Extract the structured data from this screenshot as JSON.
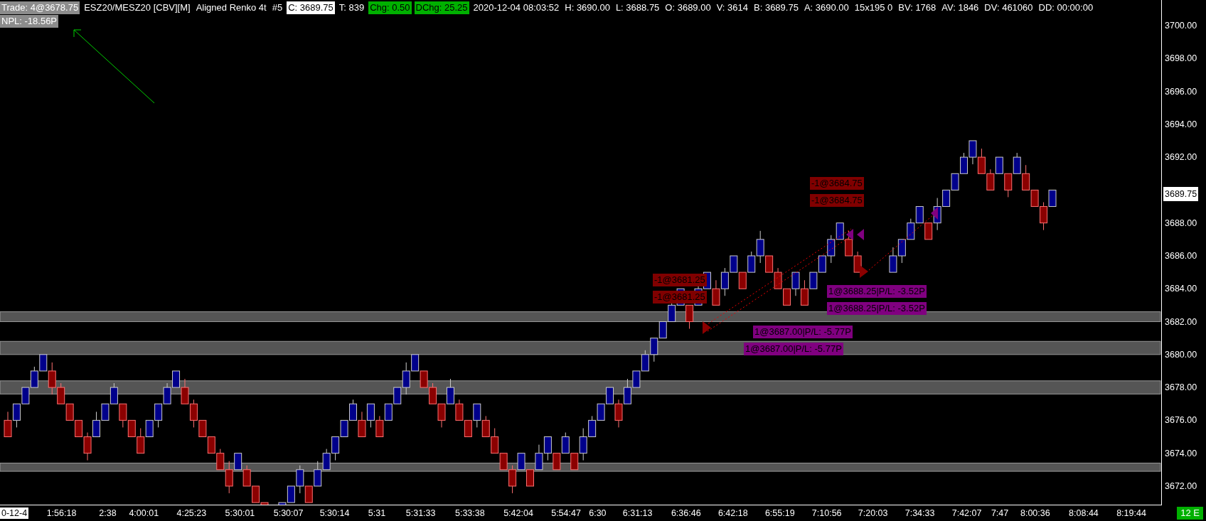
{
  "header": {
    "fields": [
      {
        "text": "Trade: 4@3678.75",
        "kind": "grey"
      },
      {
        "text": "ESZ20/MESZ20 [CBV][M]",
        "kind": "plain"
      },
      {
        "text": "Aligned Renko 4t",
        "kind": "plain"
      },
      {
        "text": "#5",
        "kind": "plain"
      },
      {
        "text": "C: 3689.75",
        "kind": "white"
      },
      {
        "text": "T: 839",
        "kind": "plain"
      },
      {
        "text": "Chg: 0.50",
        "kind": "green"
      },
      {
        "text": "DChg: 25.25",
        "kind": "green"
      },
      {
        "text": "2020-12-04 08:03:52",
        "kind": "plain"
      },
      {
        "text": "H: 3690.00",
        "kind": "plain"
      },
      {
        "text": "L: 3688.75",
        "kind": "plain"
      },
      {
        "text": "O: 3689.00",
        "kind": "plain"
      },
      {
        "text": "V: 3614",
        "kind": "plain"
      },
      {
        "text": "B: 3689.75",
        "kind": "plain"
      },
      {
        "text": "A: 3690.00",
        "kind": "plain"
      },
      {
        "text": "15x195 0",
        "kind": "plain"
      },
      {
        "text": "BV: 1768",
        "kind": "plain"
      },
      {
        "text": "AV: 1846",
        "kind": "plain"
      },
      {
        "text": "DV: 461060",
        "kind": "plain"
      },
      {
        "text": "DD: 00:00:00",
        "kind": "plain"
      }
    ],
    "npl": "NPL: -18.56P"
  },
  "trade_labels": [
    {
      "text": "-1@3684.75",
      "kind": "sell"
    },
    {
      "text": "-1@3684.75",
      "kind": "sell"
    },
    {
      "text": "-1@3681.25",
      "kind": "sell"
    },
    {
      "text": "-1@3681.25",
      "kind": "sell"
    },
    {
      "text": "1@3688.25|P/L: -3.52P",
      "kind": "buy"
    },
    {
      "text": "1@3688.25|P/L: -3.52P",
      "kind": "buy"
    },
    {
      "text": "1@3687.00|P/L: -5.77P",
      "kind": "buy"
    },
    {
      "text": "1@3687.00|P/L: -5.77P",
      "kind": "buy"
    }
  ],
  "price_axis": {
    "ticks": [
      "3700.00",
      "3698.00",
      "3696.00",
      "3694.00",
      "3692.00",
      "3688.00",
      "3686.00",
      "3684.00",
      "3682.00",
      "3680.00",
      "3678.00",
      "3676.00",
      "3674.00",
      "3672.00"
    ],
    "current_price": "3689.75"
  },
  "time_axis": {
    "labels": [
      {
        "text": "0-12-4",
        "kind": "highlight"
      },
      {
        "text": "1:56:18",
        "kind": "plain"
      },
      {
        "text": "2:38",
        "kind": "plain"
      },
      {
        "text": "4:00:01",
        "kind": "plain"
      },
      {
        "text": "4:25:23",
        "kind": "plain"
      },
      {
        "text": "5:30:01",
        "kind": "plain"
      },
      {
        "text": "5:30:07",
        "kind": "plain"
      },
      {
        "text": "5:30:14",
        "kind": "plain"
      },
      {
        "text": "5:31",
        "kind": "plain"
      },
      {
        "text": "5:31:33",
        "kind": "plain"
      },
      {
        "text": "5:33:38",
        "kind": "plain"
      },
      {
        "text": "5:42:04",
        "kind": "plain"
      },
      {
        "text": "5:54:47",
        "kind": "plain"
      },
      {
        "text": "6:30",
        "kind": "plain"
      },
      {
        "text": "6:31:13",
        "kind": "plain"
      },
      {
        "text": "6:36:46",
        "kind": "plain"
      },
      {
        "text": "6:42:18",
        "kind": "plain"
      },
      {
        "text": "6:55:19",
        "kind": "plain"
      },
      {
        "text": "7:10:56",
        "kind": "plain"
      },
      {
        "text": "7:20:03",
        "kind": "plain"
      },
      {
        "text": "7:34:33",
        "kind": "plain"
      },
      {
        "text": "7:42:07",
        "kind": "plain"
      },
      {
        "text": "7:47",
        "kind": "plain"
      },
      {
        "text": "8:00:36",
        "kind": "plain"
      },
      {
        "text": "8:08:44",
        "kind": "plain"
      },
      {
        "text": "8:19:44",
        "kind": "plain"
      }
    ],
    "badge": "12 E"
  }
}
